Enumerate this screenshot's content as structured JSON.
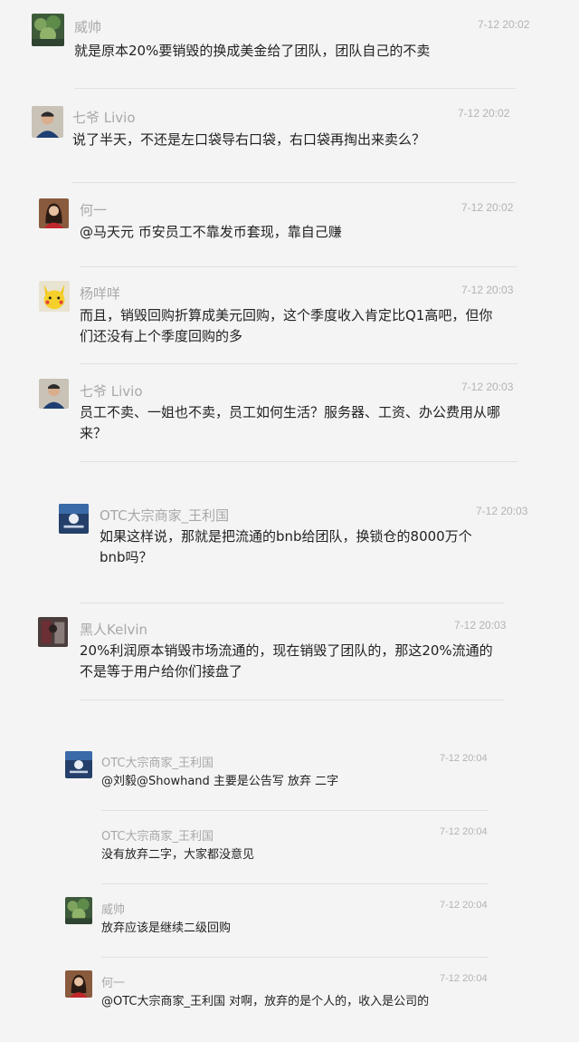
{
  "messages": [
    {
      "name": "威帅",
      "time": "7-12 20:02",
      "text": "就是原本20%要销毁的换成美金给了团队，团队自己的不卖",
      "avatar": "plant-avatar-icon"
    },
    {
      "name": "七爷 Livio",
      "time": "7-12 20:02",
      "text": "说了半天，不还是左口袋导右口袋，右口袋再掏出来卖么？",
      "avatar": "man-avatar-icon"
    },
    {
      "name": "何一",
      "time": "7-12 20:02",
      "text": "@马天元 币安员工不靠发币套现，靠自己赚",
      "avatar": "woman-avatar-icon"
    },
    {
      "name": "杨咩咩",
      "time": "7-12 20:03",
      "text": "而且，销毁回购折算成美元回购，这个季度收入肯定比Q1高吧，但你们还没有上个季度回购的多",
      "avatar": "pikachu-avatar-icon"
    },
    {
      "name": "七爷 Livio",
      "time": "7-12 20:03",
      "text": "员工不卖、一姐也不卖，员工如何生活？服务器、工资、办公费用从哪来？",
      "avatar": "man-avatar-icon"
    },
    {
      "name": "OTC大宗商家_王利国",
      "time": "7-12 20:03",
      "text": "如果这样说，那就是把流通的bnb给团队，换锁仓的8000万个bnb吗？",
      "avatar": "logo-avatar-icon"
    },
    {
      "name": "黑人Kelvin",
      "time": "7-12 20:03",
      "text": "20%利润原本销毁市场流通的，现在销毁了团队的，那这20%流通的不是等于用户给你们接盘了",
      "avatar": "dark-avatar-icon"
    },
    {
      "name": "OTC大宗商家_王利国",
      "time": "7-12 20:04",
      "text": "@刘毅@Showhand 主要是公告写 放弃 二字",
      "avatar": "logo-avatar-icon"
    },
    {
      "name": "OTC大宗商家_王利国",
      "time": "7-12 20:04",
      "text": "没有放弃二字，大家都没意见",
      "avatar": ""
    },
    {
      "name": "威帅",
      "time": "7-12 20:04",
      "text": "放弃应该是继续二级回购",
      "avatar": "plant-avatar-icon"
    },
    {
      "name": "何一",
      "time": "7-12 20:04",
      "text": "@OTC大宗商家_王利国 对啊，放弃的是个人的，收入是公司的",
      "avatar": "woman-avatar-icon"
    }
  ]
}
